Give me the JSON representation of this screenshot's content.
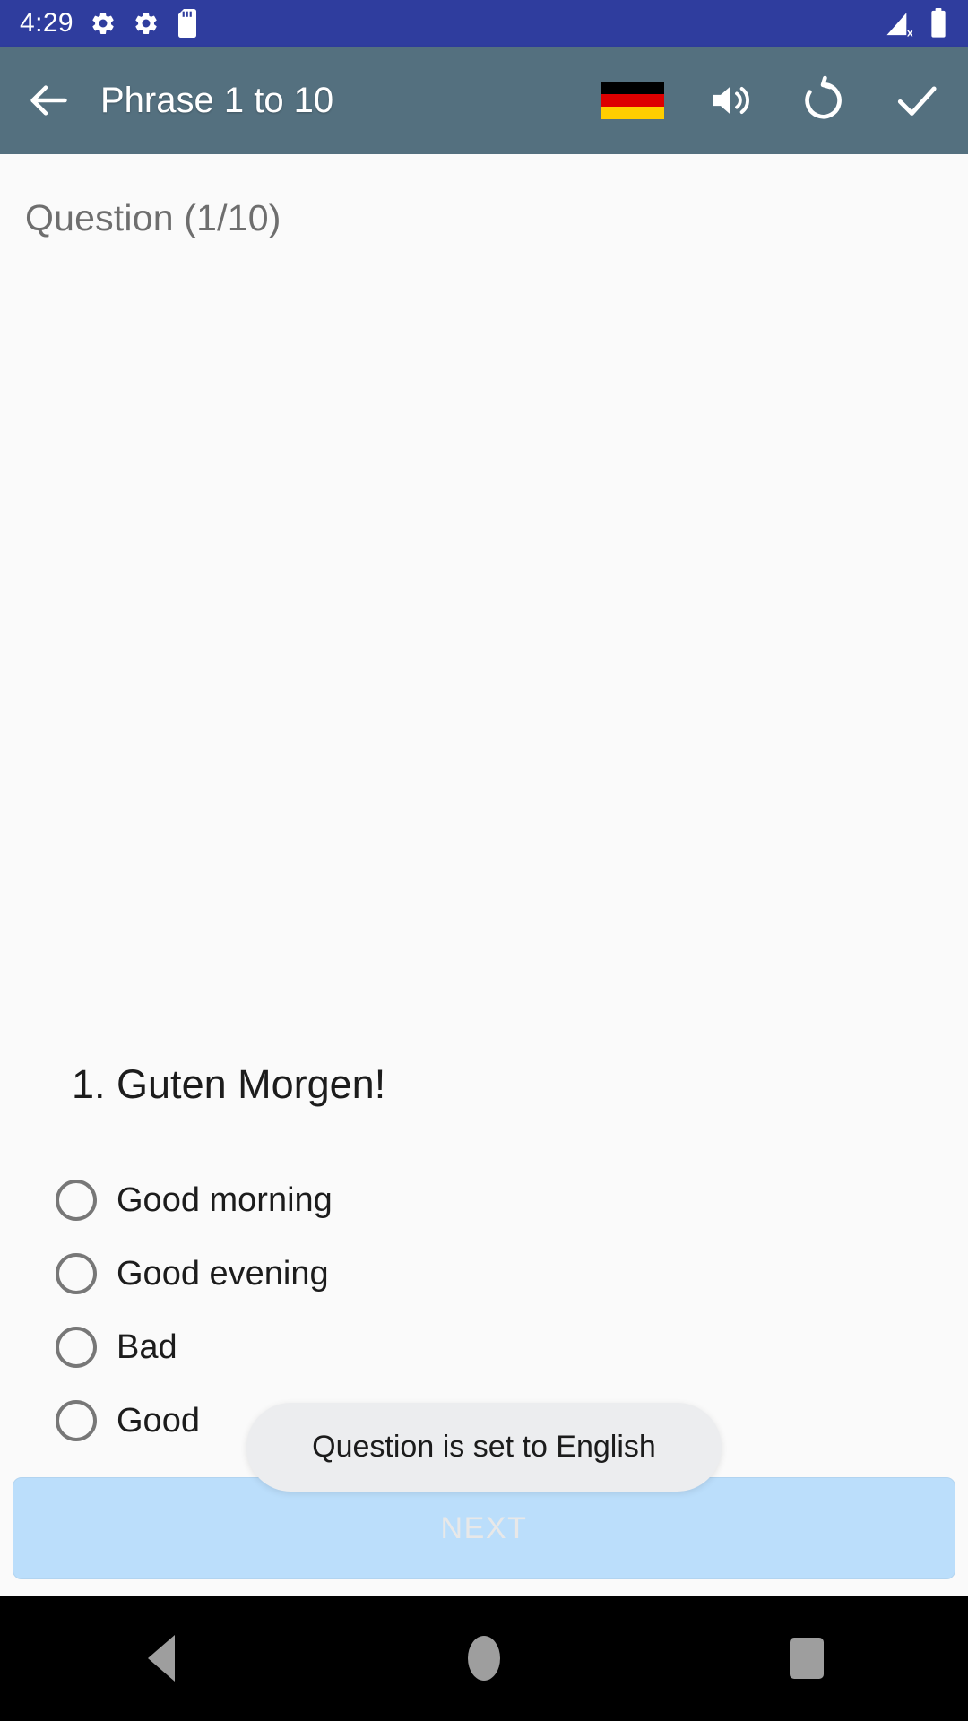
{
  "status_bar": {
    "time": "4:29",
    "left_icons": [
      "gear-icon",
      "gear-icon",
      "sd-card-icon"
    ],
    "right_icons": [
      "signal-no-sim-icon",
      "battery-full-icon"
    ],
    "background_color": "#2F3D9E"
  },
  "app_bar": {
    "back_icon": "arrow-back-icon",
    "title": "Phrase 1 to 10",
    "background_color": "#54707F",
    "actions": [
      {
        "name": "language-flag",
        "icon": "german-flag-icon",
        "label": "German"
      },
      {
        "name": "speak",
        "icon": "volume-up-icon",
        "label": "Speak"
      },
      {
        "name": "reset",
        "icon": "rotate-left-icon",
        "label": "Reset"
      },
      {
        "name": "submit",
        "icon": "check-icon",
        "label": "Submit"
      }
    ],
    "flag_colors": [
      "#000000",
      "#DD0000",
      "#FFCE00"
    ]
  },
  "main": {
    "question_counter": "Question (1/10)",
    "question_text": "1. Guten Morgen!",
    "options": [
      {
        "label": "Good morning",
        "selected": false
      },
      {
        "label": "Good evening",
        "selected": false
      },
      {
        "label": "Bad",
        "selected": false
      },
      {
        "label": "Good",
        "selected": false
      }
    ]
  },
  "next_button": {
    "label": "NEXT",
    "background_color": "#BBDEFB",
    "text_color": "#E8E8E8"
  },
  "toast": {
    "message": "Question is set to English",
    "background_color": "#ECEDEF"
  },
  "nav_bar": {
    "buttons": [
      "back-icon",
      "home-icon",
      "recents-icon"
    ],
    "background_color": "#000000"
  }
}
